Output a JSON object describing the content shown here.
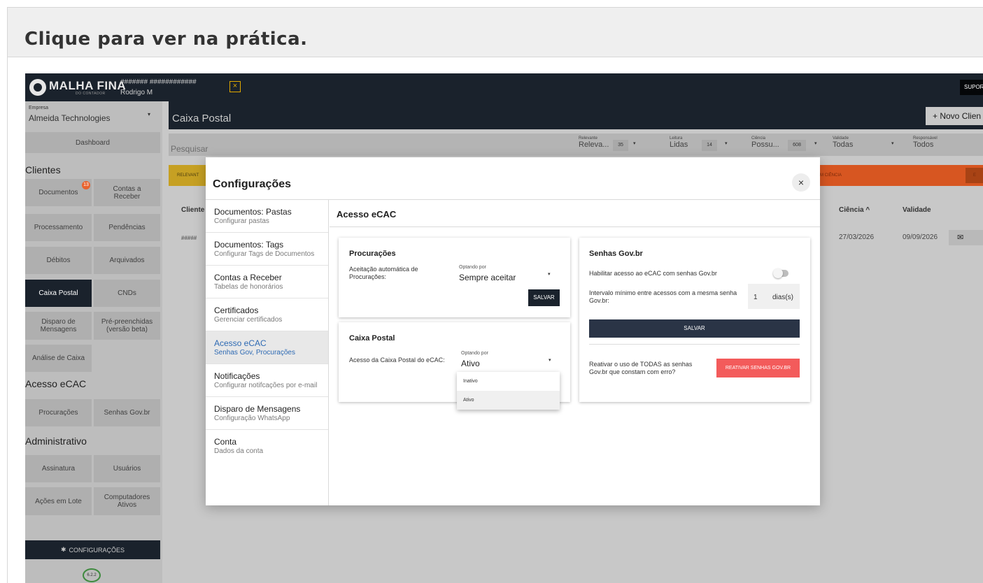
{
  "page_header": {
    "title": "Clique para ver na prática."
  },
  "topbar": {
    "logo": "MALHA FINA",
    "logo_sub": "DO CONTADOR",
    "hashes": "####### ############",
    "user": "Rodrigo M",
    "close_glyph": "×",
    "suporte": "SUPOR"
  },
  "sidebar": {
    "empresa_label": "Empresa",
    "empresa_value": "Almeida Technologies",
    "caret": "▾",
    "dashboard": "Dashboard",
    "sections": {
      "clientes": "Clientes",
      "acesso": "Acesso eCAC",
      "admin": "Administrativo"
    },
    "items": {
      "documentos": "Documentos",
      "documentos_badge": "13",
      "contas": "Contas a\nReceber",
      "processamento": "Processamento",
      "pendencias": "Pendências",
      "debitos": "Débitos",
      "arquivados": "Arquivados",
      "caixa_postal": "Caixa Postal",
      "cnds": "CNDs",
      "disparo": "Disparo de\nMensagens",
      "pre": "Pré-preenchidas\n(versão beta)",
      "analise": "Análise de Caixa",
      "procuracoes": "Procurações",
      "senhas": "Senhas Gov.br",
      "assinatura": "Assinatura",
      "usuarios": "Usuários",
      "acoes": "Ações em Lote",
      "computadores": "Computadores\nAtivos"
    },
    "config_button": "CONFIGURAÇÕES",
    "version": "6.2.2"
  },
  "main": {
    "title": "Caixa Postal",
    "novo_cliente": "+ Novo Clien",
    "search_placeholder": "Pesquisar",
    "filters": {
      "relevante": {
        "label": "Relevante",
        "value": "Releva...",
        "count": "35"
      },
      "leitura": {
        "label": "Leitura",
        "value": "Lidas",
        "count": "14"
      },
      "ciencia": {
        "label": "Ciência",
        "value": "Possu...",
        "count": "608"
      },
      "validade": {
        "label": "Validade",
        "value": "Todas"
      },
      "responsavel": {
        "label": "Responsável",
        "value": "Todos"
      }
    },
    "band_left": "RELEVANT",
    "band_right": "M CIÊNCIA",
    "band_right_btn": "E",
    "columns": {
      "cliente": "Cliente",
      "ciencia": "Ciência ^",
      "validade": "Validade"
    },
    "row": {
      "cliente": "#####",
      "ciencia": "27/03/2026",
      "validade": "09/09/2026",
      "mail_icon": "✉"
    }
  },
  "modal": {
    "title": "Configurações",
    "close": "×",
    "nav": [
      {
        "title": "Documentos: Pastas",
        "sub": "Configurar pastas"
      },
      {
        "title": "Documentos: Tags",
        "sub": "Configurar Tags de Documentos"
      },
      {
        "title": "Contas a Receber",
        "sub": "Tabelas de honorários"
      },
      {
        "title": "Certificados",
        "sub": "Gerenciar certificados"
      },
      {
        "title": "Acesso eCAC",
        "sub": "Senhas Gov, Procurações"
      },
      {
        "title": "Notificações",
        "sub": "Configurar notifcações por e-mail"
      },
      {
        "title": "Disparo de Mensagens",
        "sub": "Configuração WhatsApp"
      },
      {
        "title": "Conta",
        "sub": "Dados da conta"
      }
    ],
    "content_title": "Acesso eCAC",
    "procuracoes": {
      "title": "Procurações",
      "label": "Aceitação automática de Procurações:",
      "select_label": "Optando por",
      "select_value": "Sempre aceitar",
      "save": "SALVAR"
    },
    "caixa_postal": {
      "title": "Caixa Postal",
      "label": "Acesso da Caixa Postal do eCAC:",
      "select_label": "Optando por",
      "select_value": "Ativo",
      "options": [
        "Inativo",
        "Ativo"
      ]
    },
    "senhas": {
      "title": "Senhas Gov.br",
      "habilitar": "Habilitar acesso ao eCAC com senhas Gov.br",
      "toggle_on": false,
      "intervalo": "Intervalo mínimo entre acessos com a mesma senha Gov.br:",
      "days": "1",
      "days_unit": "dias(s)",
      "save": "SALVAR",
      "reativar_text": "Reativar o uso de TODAS as senhas Gov.br que constam com erro?",
      "reativar_btn": "REATIVAR SENHAS GOV.BR"
    }
  },
  "colors": {
    "dark": "#1a222c",
    "overlay_gray": "#c8c8c8",
    "active_link": "#2e6ab3",
    "danger": "#f35b5b",
    "relevant_band": "#c6a023",
    "ciencia_band": "#d75621",
    "badge": "#e8632e"
  }
}
